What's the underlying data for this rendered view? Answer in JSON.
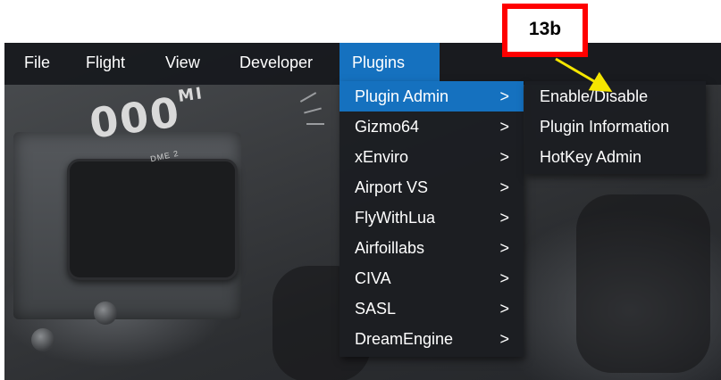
{
  "menubar": {
    "items": [
      {
        "label": "File"
      },
      {
        "label": "Flight"
      },
      {
        "label": "View"
      },
      {
        "label": "Developer"
      },
      {
        "label": "Plugins"
      }
    ]
  },
  "plugins_menu": {
    "items": [
      {
        "label": "Plugin Admin",
        "chevron": ">"
      },
      {
        "label": "Gizmo64",
        "chevron": ">"
      },
      {
        "label": "xEnviro",
        "chevron": ">"
      },
      {
        "label": "Airport VS",
        "chevron": ">"
      },
      {
        "label": "FlyWithLua",
        "chevron": ">"
      },
      {
        "label": "Airfoillabs",
        "chevron": ">"
      },
      {
        "label": "CIVA",
        "chevron": ">"
      },
      {
        "label": "SASL",
        "chevron": ">"
      },
      {
        "label": "DreamEngine",
        "chevron": ">"
      }
    ]
  },
  "plugin_admin_submenu": {
    "items": [
      {
        "label": "Enable/Disable"
      },
      {
        "label": "Plugin Information"
      },
      {
        "label": "HotKey Admin"
      }
    ]
  },
  "annotation": {
    "label": "13b",
    "border_color": "#ff0000",
    "arrow_color": "#f5e600"
  },
  "cockpit": {
    "dme_digits": "000",
    "dme_suffix": "MI",
    "dme_label": "DME 2"
  },
  "colors": {
    "menu_bg": "#181a1e",
    "highlight": "#1571bf",
    "text": "#ffffff"
  }
}
